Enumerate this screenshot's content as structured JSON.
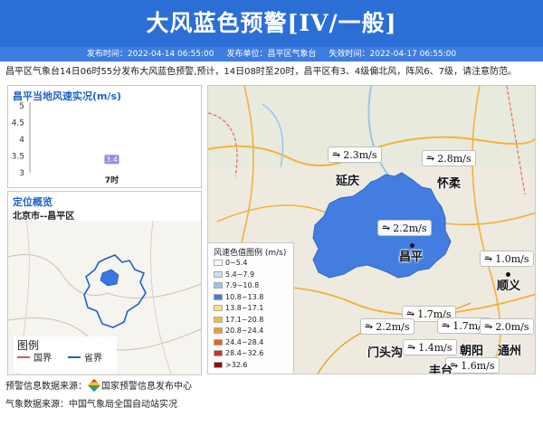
{
  "header": {
    "title": "大风蓝色预警[IV/一般]",
    "publish_time": "发布时间：2022-04-14 06:55:00",
    "publisher": "发布单位：昌平区气象台",
    "expire_time": "失效时间：2022-04-17 06:55:00"
  },
  "summary": "昌平区气象台14日06时55分发布大风蓝色预警,预计，14日08时至20时，昌平区有3、4级偏北风，阵风6、7级，请注意防范。",
  "wind_panel": {
    "title": "昌平当地风速实况(m/s)",
    "chart_data": {
      "type": "bar",
      "categories": [
        "7时"
      ],
      "values": [
        3.4
      ],
      "data_labels": [
        "3.4"
      ],
      "y_ticks": [
        "5",
        "4.5",
        "4",
        "3.5",
        "3"
      ],
      "ylim": [
        3,
        5
      ]
    }
  },
  "location_panel": {
    "title": "定位概览",
    "location": "北京市--昌平区",
    "legend_title": "图例",
    "legend_items": [
      {
        "label": "国界",
        "color": "#c66060"
      },
      {
        "label": "省界",
        "color": "#1f5fd0"
      }
    ]
  },
  "map": {
    "wind_labels": [
      {
        "speed": "2.3m/s"
      },
      {
        "speed": "2.8m/s"
      },
      {
        "speed": "2.2m/s"
      },
      {
        "speed": "1.0m/s"
      },
      {
        "speed": "1.7m/s"
      },
      {
        "speed": "2.2m/s"
      },
      {
        "speed": "1.7m/s"
      },
      {
        "speed": "2.0m/s"
      },
      {
        "speed": "1.4m/s"
      },
      {
        "speed": "1.6m/s"
      }
    ],
    "wind_icon_glyph": "⥲",
    "cities": [
      "延庆",
      "怀柔",
      "昌平",
      "顺义",
      "门头沟",
      "朝阳",
      "通州",
      "丰台"
    ],
    "highlight_color": "#3a78e0",
    "legend": {
      "title": "风速色值图例 (m/s)",
      "items": [
        {
          "label": "0~5.4",
          "color": "#ffffff"
        },
        {
          "label": "5.4~7.9",
          "color": "#c7e0f7"
        },
        {
          "label": "7.9~10.8",
          "color": "#96c3ef"
        },
        {
          "label": "10.8~13.8",
          "color": "#3f7fe0"
        },
        {
          "label": "13.8~17.1",
          "color": "#f5e37a"
        },
        {
          "label": "17.1~20.8",
          "color": "#f2c13c"
        },
        {
          "label": "20.8~24.4",
          "color": "#f29a2e"
        },
        {
          "label": "24.4~28.4",
          "color": "#e8621f"
        },
        {
          "label": "28.4~32.6",
          "color": "#d0341a"
        },
        {
          "label": ">32.6",
          "color": "#8e0f0f"
        }
      ]
    }
  },
  "footer": {
    "warning_source_label": "预警信息数据来源：",
    "warning_source": "国家预警信息发布中心",
    "weather_source": "气象数据来源：中国气象局全国自动站实况"
  },
  "colors": {
    "header_bg": "#2b6fd6",
    "title_blue": "#1e63c9"
  }
}
